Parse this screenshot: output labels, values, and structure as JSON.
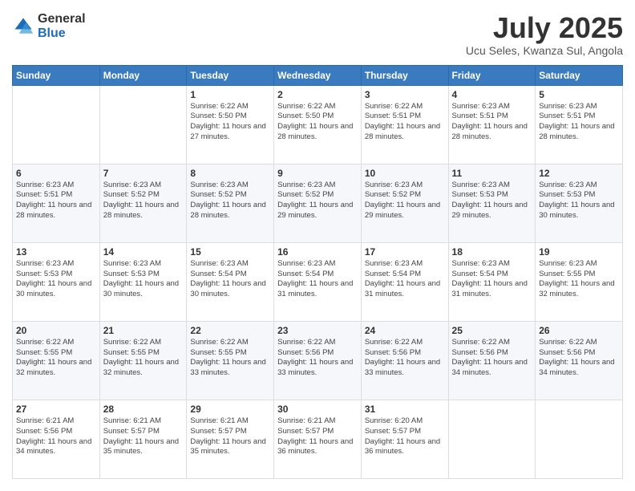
{
  "logo": {
    "general": "General",
    "blue": "Blue"
  },
  "header": {
    "month": "July 2025",
    "location": "Ucu Seles, Kwanza Sul, Angola"
  },
  "days_of_week": [
    "Sunday",
    "Monday",
    "Tuesday",
    "Wednesday",
    "Thursday",
    "Friday",
    "Saturday"
  ],
  "weeks": [
    [
      {
        "day": "",
        "info": ""
      },
      {
        "day": "",
        "info": ""
      },
      {
        "day": "1",
        "info": "Sunrise: 6:22 AM\nSunset: 5:50 PM\nDaylight: 11 hours and 27 minutes."
      },
      {
        "day": "2",
        "info": "Sunrise: 6:22 AM\nSunset: 5:50 PM\nDaylight: 11 hours and 28 minutes."
      },
      {
        "day": "3",
        "info": "Sunrise: 6:22 AM\nSunset: 5:51 PM\nDaylight: 11 hours and 28 minutes."
      },
      {
        "day": "4",
        "info": "Sunrise: 6:23 AM\nSunset: 5:51 PM\nDaylight: 11 hours and 28 minutes."
      },
      {
        "day": "5",
        "info": "Sunrise: 6:23 AM\nSunset: 5:51 PM\nDaylight: 11 hours and 28 minutes."
      }
    ],
    [
      {
        "day": "6",
        "info": "Sunrise: 6:23 AM\nSunset: 5:51 PM\nDaylight: 11 hours and 28 minutes."
      },
      {
        "day": "7",
        "info": "Sunrise: 6:23 AM\nSunset: 5:52 PM\nDaylight: 11 hours and 28 minutes."
      },
      {
        "day": "8",
        "info": "Sunrise: 6:23 AM\nSunset: 5:52 PM\nDaylight: 11 hours and 28 minutes."
      },
      {
        "day": "9",
        "info": "Sunrise: 6:23 AM\nSunset: 5:52 PM\nDaylight: 11 hours and 29 minutes."
      },
      {
        "day": "10",
        "info": "Sunrise: 6:23 AM\nSunset: 5:52 PM\nDaylight: 11 hours and 29 minutes."
      },
      {
        "day": "11",
        "info": "Sunrise: 6:23 AM\nSunset: 5:53 PM\nDaylight: 11 hours and 29 minutes."
      },
      {
        "day": "12",
        "info": "Sunrise: 6:23 AM\nSunset: 5:53 PM\nDaylight: 11 hours and 30 minutes."
      }
    ],
    [
      {
        "day": "13",
        "info": "Sunrise: 6:23 AM\nSunset: 5:53 PM\nDaylight: 11 hours and 30 minutes."
      },
      {
        "day": "14",
        "info": "Sunrise: 6:23 AM\nSunset: 5:53 PM\nDaylight: 11 hours and 30 minutes."
      },
      {
        "day": "15",
        "info": "Sunrise: 6:23 AM\nSunset: 5:54 PM\nDaylight: 11 hours and 30 minutes."
      },
      {
        "day": "16",
        "info": "Sunrise: 6:23 AM\nSunset: 5:54 PM\nDaylight: 11 hours and 31 minutes."
      },
      {
        "day": "17",
        "info": "Sunrise: 6:23 AM\nSunset: 5:54 PM\nDaylight: 11 hours and 31 minutes."
      },
      {
        "day": "18",
        "info": "Sunrise: 6:23 AM\nSunset: 5:54 PM\nDaylight: 11 hours and 31 minutes."
      },
      {
        "day": "19",
        "info": "Sunrise: 6:23 AM\nSunset: 5:55 PM\nDaylight: 11 hours and 32 minutes."
      }
    ],
    [
      {
        "day": "20",
        "info": "Sunrise: 6:22 AM\nSunset: 5:55 PM\nDaylight: 11 hours and 32 minutes."
      },
      {
        "day": "21",
        "info": "Sunrise: 6:22 AM\nSunset: 5:55 PM\nDaylight: 11 hours and 32 minutes."
      },
      {
        "day": "22",
        "info": "Sunrise: 6:22 AM\nSunset: 5:55 PM\nDaylight: 11 hours and 33 minutes."
      },
      {
        "day": "23",
        "info": "Sunrise: 6:22 AM\nSunset: 5:56 PM\nDaylight: 11 hours and 33 minutes."
      },
      {
        "day": "24",
        "info": "Sunrise: 6:22 AM\nSunset: 5:56 PM\nDaylight: 11 hours and 33 minutes."
      },
      {
        "day": "25",
        "info": "Sunrise: 6:22 AM\nSunset: 5:56 PM\nDaylight: 11 hours and 34 minutes."
      },
      {
        "day": "26",
        "info": "Sunrise: 6:22 AM\nSunset: 5:56 PM\nDaylight: 11 hours and 34 minutes."
      }
    ],
    [
      {
        "day": "27",
        "info": "Sunrise: 6:21 AM\nSunset: 5:56 PM\nDaylight: 11 hours and 34 minutes."
      },
      {
        "day": "28",
        "info": "Sunrise: 6:21 AM\nSunset: 5:57 PM\nDaylight: 11 hours and 35 minutes."
      },
      {
        "day": "29",
        "info": "Sunrise: 6:21 AM\nSunset: 5:57 PM\nDaylight: 11 hours and 35 minutes."
      },
      {
        "day": "30",
        "info": "Sunrise: 6:21 AM\nSunset: 5:57 PM\nDaylight: 11 hours and 36 minutes."
      },
      {
        "day": "31",
        "info": "Sunrise: 6:20 AM\nSunset: 5:57 PM\nDaylight: 11 hours and 36 minutes."
      },
      {
        "day": "",
        "info": ""
      },
      {
        "day": "",
        "info": ""
      }
    ]
  ]
}
